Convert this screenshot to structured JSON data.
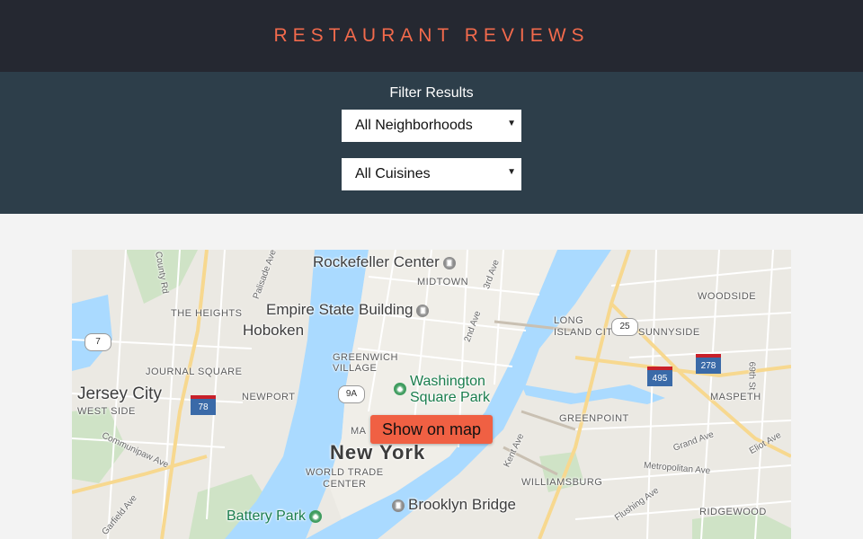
{
  "header": {
    "title": "RESTAURANT REVIEWS"
  },
  "filter": {
    "label": "Filter Results",
    "neighborhood_select": "All Neighborhoods",
    "cuisine_select": "All Cuisines"
  },
  "map": {
    "show_button": "Show on map",
    "labels": {
      "rockefeller": "Rockefeller Center",
      "midtown": "MIDTOWN",
      "empire": "Empire State Building",
      "hoboken": "Hoboken",
      "heights": "THE HEIGHTS",
      "journal_square": "JOURNAL SQUARE",
      "jersey_city": "Jersey City",
      "west_side": "WEST SIDE",
      "newport": "NEWPORT",
      "greenwich": "GREENWICH\nVILLAGE",
      "washington_sq": "Washington\nSquare Park",
      "long_island_city": "LONG\nISLAND CITY",
      "sunnyside": "SUNNYSIDE",
      "woodside": "WOODSIDE",
      "maspeth": "MASPETH",
      "greenpoint": "GREENPOINT",
      "new_york": "New York",
      "world_trade": "WORLD TRADE\nCENTER",
      "williamsburg": "WILLIAMSBURG",
      "brooklyn_bridge": "Brooklyn Bridge",
      "battery_park": "Battery Park",
      "ridgewood": "RIDGEWOOD",
      "ma": "MA",
      "pallisade": "Palisade Ave",
      "county_rd": "County Rd",
      "third_ave": "3rd Ave",
      "second_ave": "2nd Ave",
      "kent_ave": "Kent Ave",
      "grand_ave": "Grand Ave",
      "eliot_ave": "Eliot Ave",
      "metropolitan": "Metropolitan Ave",
      "flushing": "Flushing Ave",
      "communipaw": "Communipaw Ave",
      "garfield": "Garfield Ave",
      "69th": "69th St",
      "r7": "7",
      "r78": "78",
      "r9a": "9A",
      "r25": "25",
      "r495": "495",
      "r278": "278"
    }
  }
}
